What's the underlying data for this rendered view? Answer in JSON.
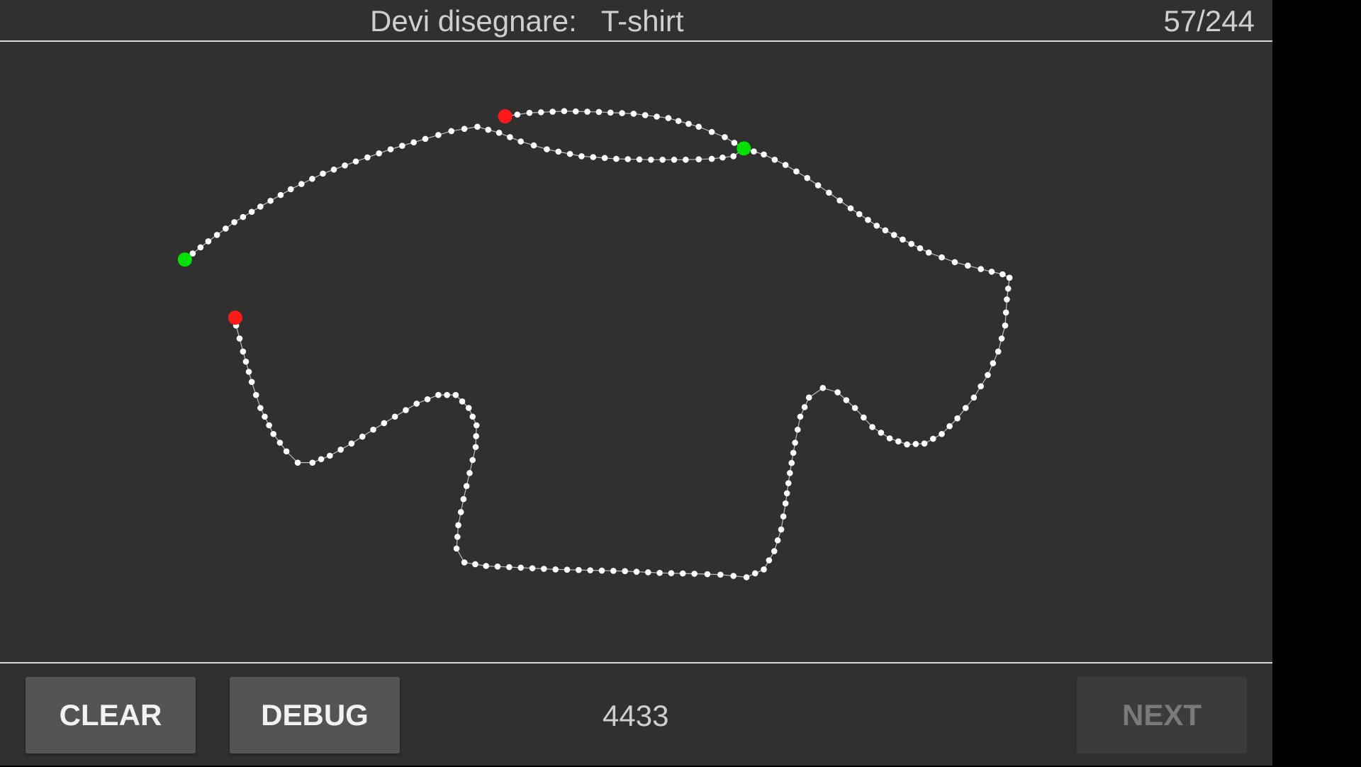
{
  "header": {
    "prompt_label": "Devi disegnare:",
    "prompt_word": "T-shirt",
    "progress": "57/244"
  },
  "footer": {
    "clear_label": "CLEAR",
    "debug_label": "DEBUG",
    "score": "4433",
    "next_label": "NEXT",
    "next_enabled": false
  },
  "colors": {
    "background": "#303030",
    "stroke_points": "#ffffff",
    "stroke_start": "#00e000",
    "stroke_end": "#ff1a1a"
  }
}
